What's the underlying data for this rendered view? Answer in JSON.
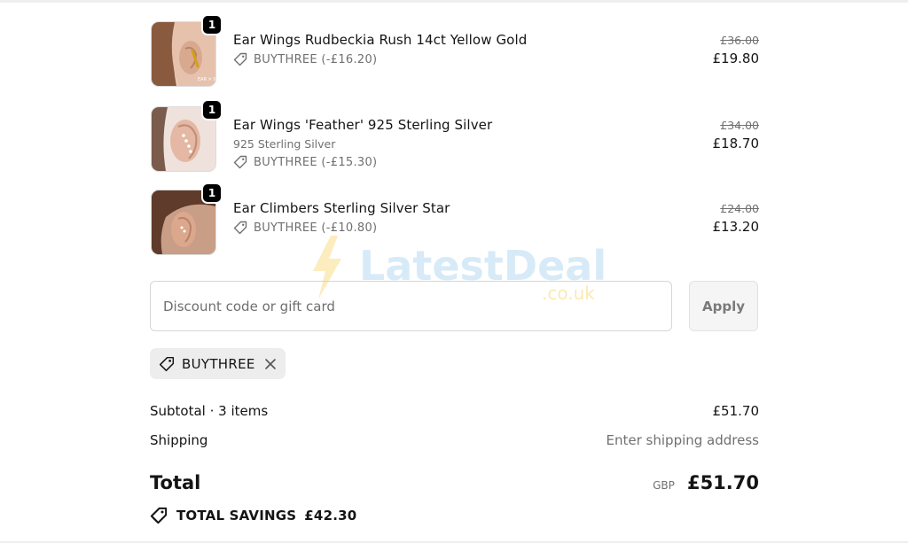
{
  "items": [
    {
      "title": "Ear Wings Rudbeckia Rush 14ct Yellow Gold",
      "variant": "",
      "discount": "BUYTHREE (-£16.20)",
      "old_price": "£36.00",
      "new_price": "£19.80",
      "quantity": "1",
      "image_icon": "earring-model-photo"
    },
    {
      "title": "Ear Wings 'Feather' 925 Sterling Silver",
      "variant": "925 Sterling Silver",
      "discount": "BUYTHREE (-£15.30)",
      "old_price": "£34.00",
      "new_price": "£18.70",
      "quantity": "1",
      "image_icon": "earring-model-photo"
    },
    {
      "title": "Ear Climbers Sterling Silver Star",
      "variant": "",
      "discount": "BUYTHREE (-£10.80)",
      "old_price": "£24.00",
      "new_price": "£13.20",
      "quantity": "1",
      "image_icon": "earring-model-photo"
    }
  ],
  "discount_field": {
    "placeholder": "Discount code or gift card",
    "value": ""
  },
  "apply_button": {
    "label": "Apply"
  },
  "applied_code": {
    "label": "BUYTHREE",
    "icon": "tag-icon",
    "remove_icon": "close-icon"
  },
  "summary": {
    "subtotal_label": "Subtotal · 3 items",
    "subtotal_value": "£51.70",
    "shipping_label": "Shipping",
    "shipping_value": "Enter shipping address",
    "total_label": "Total",
    "currency": "GBP",
    "total_value": "£51.70",
    "savings_label": "TOTAL SAVINGS",
    "savings_value": "£42.30"
  },
  "watermark": {
    "text": "LatestDeals",
    "subtext": ".co.uk"
  },
  "colors": {
    "text": "#141414",
    "muted": "#707070",
    "chip_bg": "#ededed",
    "badge": "#000000",
    "border": "#d6d6d6"
  }
}
